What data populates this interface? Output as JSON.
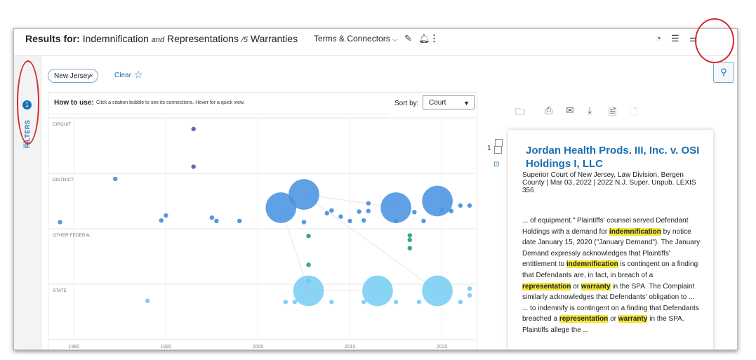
{
  "header": {
    "results_for": "Results for:",
    "q1": "Indemnification",
    "op1": "and",
    "q2": "Representations",
    "op2": "/5",
    "q3": "Warranties",
    "mode": "Terms & Connectors",
    "mode_chevron_icon": "chevron-down-icon"
  },
  "rail": {
    "badge": "1",
    "label": "FILTERS"
  },
  "chip": {
    "label": "New Jersey",
    "close": "×"
  },
  "clear_label": "Clear",
  "howto": {
    "bold": "How to use:",
    "text": "Click a citation bubble to see its connections. Hover for a quick view."
  },
  "sort": {
    "label": "Sort by:",
    "value": "Court"
  },
  "chart_data": {
    "type": "scatter",
    "title": "",
    "xlabel": "",
    "ylabel": "",
    "xlim": [
      1978,
      2023
    ],
    "x_ticks": [
      1980,
      1990,
      2000,
      2010,
      2020
    ],
    "categories": [
      "CIRCUIT",
      "DISTRICT",
      "OTHER FEDERAL",
      "STATE"
    ],
    "colors": {
      "CIRCUIT": "#5e5fb4",
      "DISTRICT": "#4a93e0",
      "OTHER FEDERAL": "#2aa190",
      "STATE": "#79cdf2"
    },
    "points": [
      {
        "cat": "CIRCUIT",
        "x": 1993,
        "y": 0.2,
        "r": 0.1
      },
      {
        "cat": "CIRCUIT",
        "x": 1993,
        "y": 0.88,
        "r": 0.1
      },
      {
        "cat": "DISTRICT",
        "x": 1984.5,
        "y": 0.1,
        "r": 0.1
      },
      {
        "cat": "DISTRICT",
        "x": 1978.5,
        "y": 0.88,
        "r": 0.1
      },
      {
        "cat": "DISTRICT",
        "x": 1989.5,
        "y": 0.85,
        "r": 0.1
      },
      {
        "cat": "DISTRICT",
        "x": 1990,
        "y": 0.76,
        "r": 0.1
      },
      {
        "cat": "DISTRICT",
        "x": 1995,
        "y": 0.8,
        "r": 0.1
      },
      {
        "cat": "DISTRICT",
        "x": 1995.5,
        "y": 0.86,
        "r": 0.1
      },
      {
        "cat": "DISTRICT",
        "x": 1998,
        "y": 0.86,
        "r": 0.1
      },
      {
        "cat": "DISTRICT",
        "x": 2002.5,
        "y": 0.62,
        "r": 0.95
      },
      {
        "cat": "DISTRICT",
        "x": 2005,
        "y": 0.38,
        "r": 0.95
      },
      {
        "cat": "DISTRICT",
        "x": 2005,
        "y": 0.88,
        "r": 0.1
      },
      {
        "cat": "DISTRICT",
        "x": 2007.5,
        "y": 0.72,
        "r": 0.1
      },
      {
        "cat": "DISTRICT",
        "x": 2008,
        "y": 0.67,
        "r": 0.1
      },
      {
        "cat": "DISTRICT",
        "x": 2009,
        "y": 0.78,
        "r": 0.1
      },
      {
        "cat": "DISTRICT",
        "x": 2010,
        "y": 0.86,
        "r": 0.1
      },
      {
        "cat": "DISTRICT",
        "x": 2011,
        "y": 0.69,
        "r": 0.1
      },
      {
        "cat": "DISTRICT",
        "x": 2011.5,
        "y": 0.85,
        "r": 0.1
      },
      {
        "cat": "DISTRICT",
        "x": 2012,
        "y": 0.68,
        "r": 0.1
      },
      {
        "cat": "DISTRICT",
        "x": 2012,
        "y": 0.54,
        "r": 0.1
      },
      {
        "cat": "DISTRICT",
        "x": 2015,
        "y": 0.62,
        "r": 0.95
      },
      {
        "cat": "DISTRICT",
        "x": 2015,
        "y": 0.86,
        "r": 0.1
      },
      {
        "cat": "DISTRICT",
        "x": 2017,
        "y": 0.7,
        "r": 0.1
      },
      {
        "cat": "DISTRICT",
        "x": 2018,
        "y": 0.86,
        "r": 0.1
      },
      {
        "cat": "DISTRICT",
        "x": 2019.5,
        "y": 0.5,
        "r": 0.95
      },
      {
        "cat": "DISTRICT",
        "x": 2020,
        "y": 0.66,
        "r": 0.1
      },
      {
        "cat": "DISTRICT",
        "x": 2021,
        "y": 0.68,
        "r": 0.1
      },
      {
        "cat": "DISTRICT",
        "x": 2022,
        "y": 0.58,
        "r": 0.1
      },
      {
        "cat": "DISTRICT",
        "x": 2023,
        "y": 0.58,
        "r": 0.1
      },
      {
        "cat": "OTHER FEDERAL",
        "x": 2005.5,
        "y": 0.13,
        "r": 0.1
      },
      {
        "cat": "OTHER FEDERAL",
        "x": 2016.5,
        "y": 0.12,
        "r": 0.1
      },
      {
        "cat": "OTHER FEDERAL",
        "x": 2016.5,
        "y": 0.2,
        "r": 0.1
      },
      {
        "cat": "OTHER FEDERAL",
        "x": 2016.5,
        "y": 0.35,
        "r": 0.1
      },
      {
        "cat": "OTHER FEDERAL",
        "x": 2005.5,
        "y": 0.65,
        "r": 0.1
      },
      {
        "cat": "OTHER FEDERAL",
        "x": 2005.5,
        "y": 0.94,
        "r": 0.1
      },
      {
        "cat": "STATE",
        "x": 1988,
        "y": 0.3,
        "r": 0.1
      },
      {
        "cat": "STATE",
        "x": 2005.5,
        "y": 0.12,
        "r": 0.95
      },
      {
        "cat": "STATE",
        "x": 2013,
        "y": 0.12,
        "r": 0.95
      },
      {
        "cat": "STATE",
        "x": 2019.5,
        "y": 0.12,
        "r": 0.95
      },
      {
        "cat": "STATE",
        "x": 2003,
        "y": 0.32,
        "r": 0.1
      },
      {
        "cat": "STATE",
        "x": 2004,
        "y": 0.32,
        "r": 0.1
      },
      {
        "cat": "STATE",
        "x": 2008,
        "y": 0.32,
        "r": 0.1
      },
      {
        "cat": "STATE",
        "x": 2011.5,
        "y": 0.32,
        "r": 0.1
      },
      {
        "cat": "STATE",
        "x": 2015,
        "y": 0.32,
        "r": 0.1
      },
      {
        "cat": "STATE",
        "x": 2017.5,
        "y": 0.32,
        "r": 0.1
      },
      {
        "cat": "STATE",
        "x": 2022,
        "y": 0.32,
        "r": 0.1
      },
      {
        "cat": "STATE",
        "x": 2023,
        "y": 0.2,
        "r": 0.1
      },
      {
        "cat": "STATE",
        "x": 2023,
        "y": 0.08,
        "r": 0.1
      }
    ]
  },
  "result": {
    "number": "1",
    "title": "Jordan Health Prods. III, Inc. v. OSI Holdings I, LLC",
    "meta": "Superior Court of New Jersey, Law Division, Bergen County | Mar 03, 2022 | 2022 N.J. Super. Unpub. LEXIS 356",
    "p1a": "... of equipment.\" Plaintiffs' counsel served Defendant Holdings with a demand for ",
    "h1": "indemnification",
    "p1b": " by notice date January 15, 2020 (\"January Demand\"). The January Demand expressly acknowledges that Plaintiffs' entitlement to ",
    "h2": "indemnification",
    "p1c": " is contingent on a finding that Defendants are, in fact, in breach of a ",
    "h3": "representation",
    "p1d": " or ",
    "h4": "warranty",
    "p1e": " in the SPA. The Complaint similarly acknowledges that Defendants' obligation to ...",
    "p2a": "... to indemnify is contingent on a finding that Defendants breached a ",
    "h5": "representation",
    "p2b": " or ",
    "h6": "warranty",
    "p2c": " in the SPA. Plaintiffs allege the ..."
  }
}
